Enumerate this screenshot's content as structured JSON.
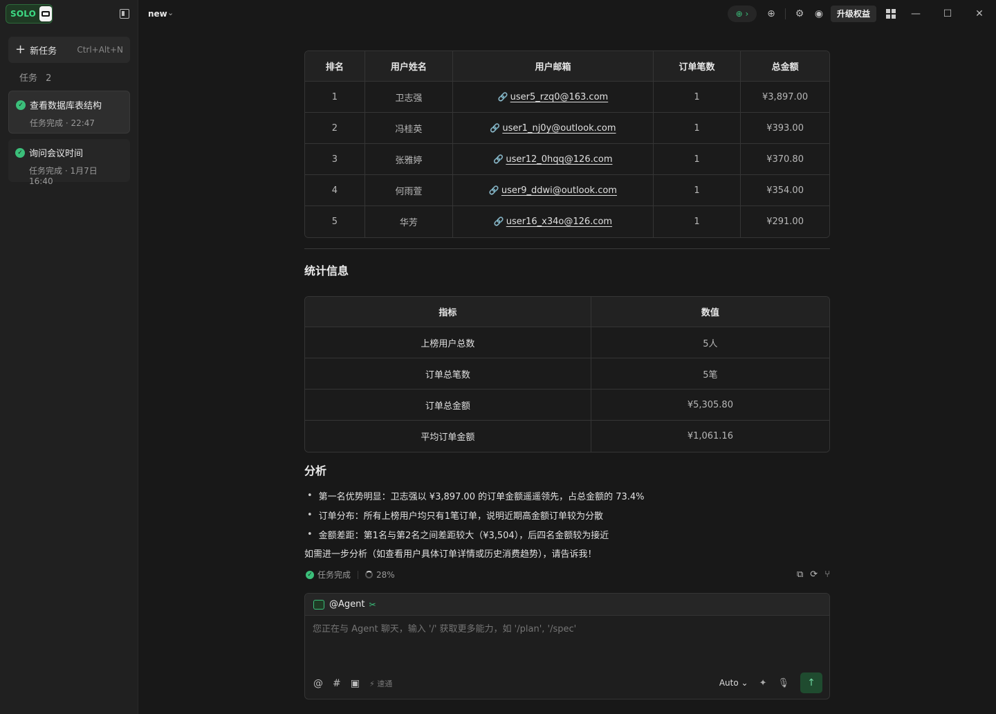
{
  "app": {
    "logo_text": "SOLO",
    "tab_name": "new"
  },
  "sidebar": {
    "new_task_label": "新任务",
    "new_task_shortcut": "Ctrl+Alt+N",
    "section_label": "任务",
    "section_count": "2",
    "tasks": [
      {
        "title": "查看数据库表结构",
        "subtitle": "任务完成 · 22:47"
      },
      {
        "title": "询问会议时间",
        "subtitle": "任务完成 · 1月7日 16:40"
      }
    ]
  },
  "topbar": {
    "upgrade_label": "升级权益"
  },
  "rank_table": {
    "headers": [
      "排名",
      "用户姓名",
      "用户邮箱",
      "订单笔数",
      "总金额"
    ],
    "rows": [
      [
        "1",
        "卫志强",
        "user5_rzq0@163.com",
        "1",
        "¥3,897.00"
      ],
      [
        "2",
        "冯桂英",
        "user1_nj0y@outlook.com",
        "1",
        "¥393.00"
      ],
      [
        "3",
        "张雅婷",
        "user12_0hqq@126.com",
        "1",
        "¥370.80"
      ],
      [
        "4",
        "何雨萱",
        "user9_ddwi@outlook.com",
        "1",
        "¥354.00"
      ],
      [
        "5",
        "华芳",
        "user16_x34o@126.com",
        "1",
        "¥291.00"
      ]
    ]
  },
  "stats": {
    "heading": "统计信息",
    "headers": [
      "指标",
      "数值"
    ],
    "rows": [
      [
        "上榜用户总数",
        "5人"
      ],
      [
        "订单总笔数",
        "5笔"
      ],
      [
        "订单总金额",
        "¥5,305.80"
      ],
      [
        "平均订单金额",
        "¥1,061.16"
      ]
    ]
  },
  "analysis": {
    "heading": "分析",
    "bullets": [
      "第一名优势明显：卫志强以 ¥3,897.00 的订单金额遥遥领先，占总金额的 73.4%",
      "订单分布：所有上榜用户均只有1笔订单，说明近期高金额订单较为分散",
      "金额差距：第1名与第2名之间差距较大（¥3,504），后四名金额较为接近"
    ],
    "closing": "如需进一步分析（如查看用户具体订单详情或历史消费趋势），请告诉我！"
  },
  "status": {
    "done_label": "任务完成",
    "progress": "28%"
  },
  "composer": {
    "agent_label": "@Agent",
    "placeholder": "您正在与 Agent 聊天，输入 '/' 获取更多能力，如 '/plan', '/spec'",
    "speed_label": "速通",
    "model": "Auto"
  }
}
